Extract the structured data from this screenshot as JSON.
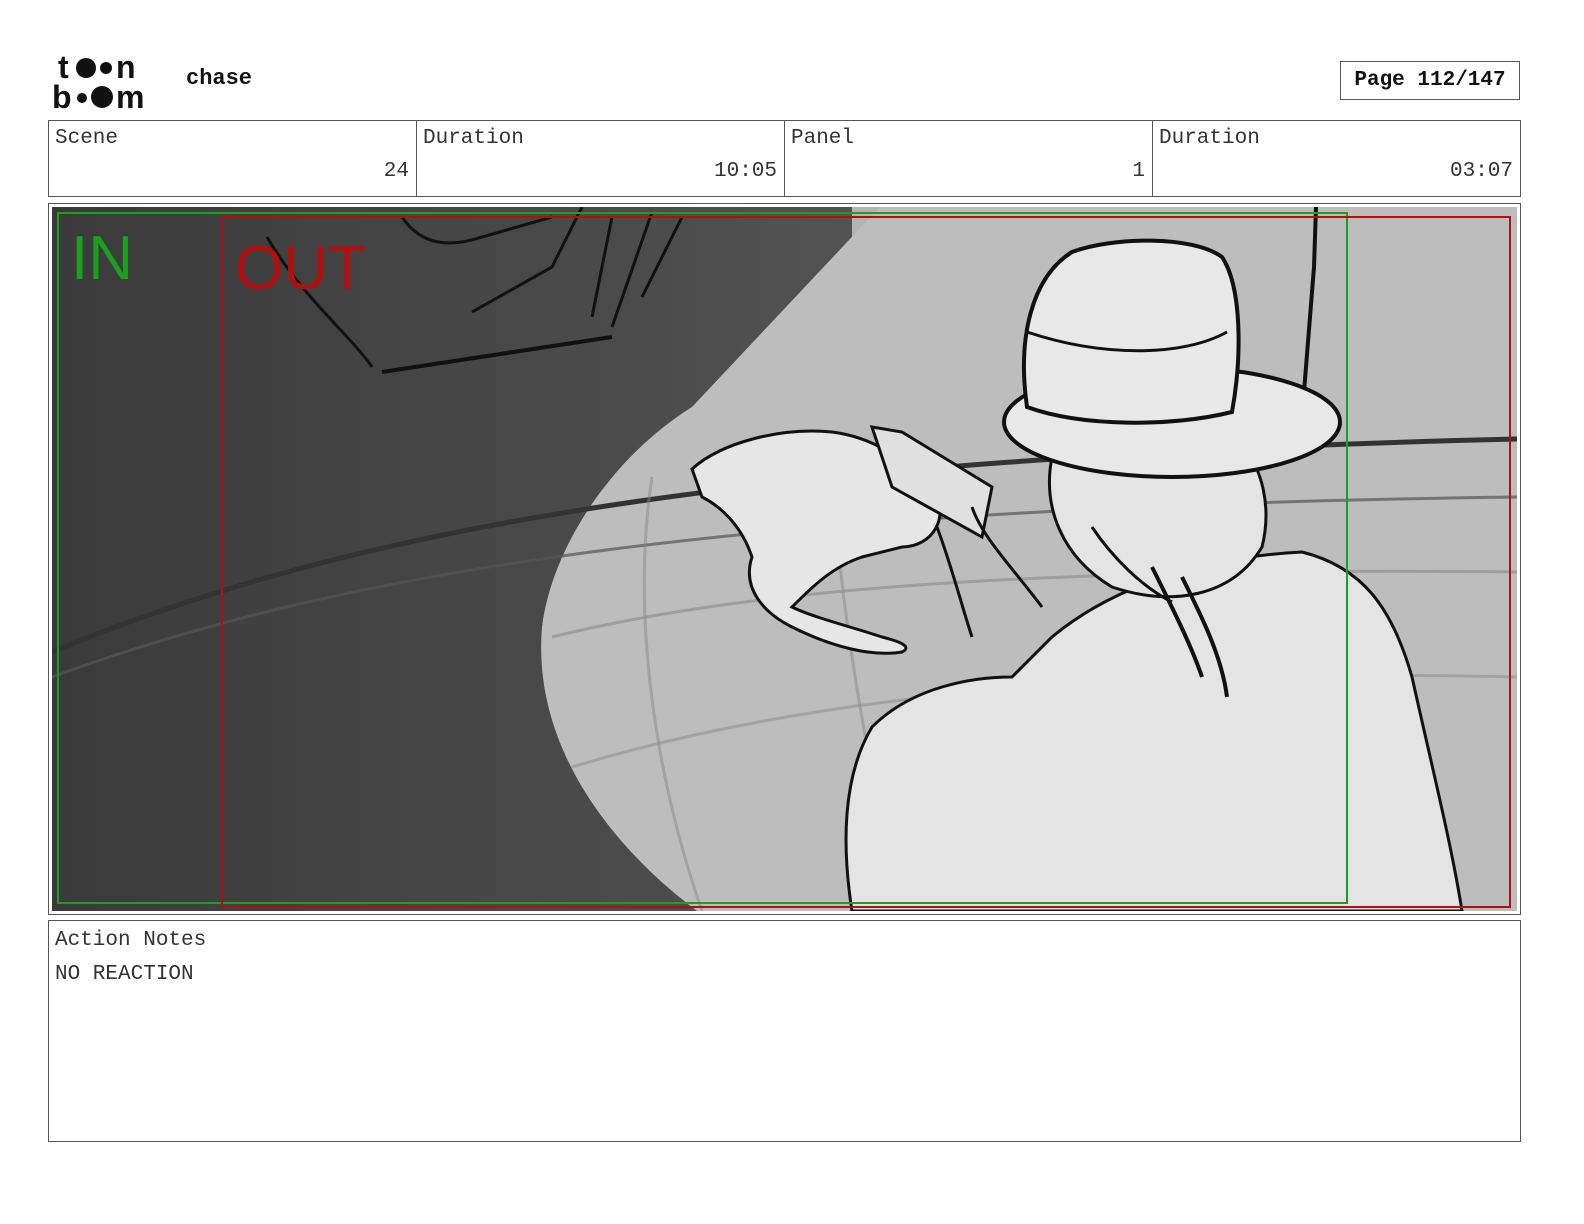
{
  "header": {
    "project_title": "chase",
    "page_label": "Page 112/147"
  },
  "info": [
    {
      "label": "Scene",
      "value": "24"
    },
    {
      "label": "Duration",
      "value": "10:05"
    },
    {
      "label": "Panel",
      "value": "1"
    },
    {
      "label": "Duration",
      "value": "03:07"
    }
  ],
  "panel": {
    "in_marker": "IN",
    "out_marker": "OUT",
    "in_color": "#1aa01a",
    "out_color": "#b01010"
  },
  "notes": {
    "label": "Action Notes",
    "text": "NO REACTION"
  }
}
